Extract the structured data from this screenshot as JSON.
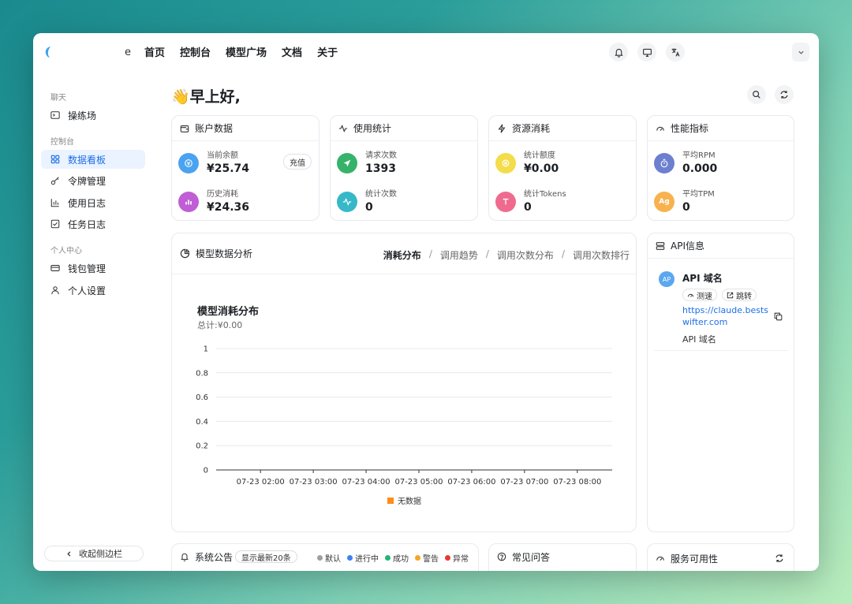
{
  "nav": {
    "logo_tail": "e",
    "items": [
      "首页",
      "控制台",
      "模型广场",
      "文档",
      "关于"
    ]
  },
  "sidebar": {
    "sections": [
      {
        "label": "聊天",
        "items": [
          {
            "label": "操练场"
          }
        ]
      },
      {
        "label": "控制台",
        "items": [
          {
            "label": "数据看板"
          },
          {
            "label": "令牌管理"
          },
          {
            "label": "使用日志"
          },
          {
            "label": "任务日志"
          }
        ]
      },
      {
        "label": "个人中心",
        "items": [
          {
            "label": "钱包管理"
          },
          {
            "label": "个人设置"
          }
        ]
      }
    ],
    "active": "数据看板",
    "collapse_label": "收起侧边栏"
  },
  "greeting": "👋早上好,",
  "account": {
    "title": "账户数据",
    "balance_label": "当前余额",
    "balance_value": "¥25.74",
    "recharge_label": "充值",
    "history_label": "历史消耗",
    "history_value": "¥24.36"
  },
  "usage": {
    "title": "使用统计",
    "requests_label": "请求次数",
    "requests_value": "1393",
    "stat_count_label": "统计次数",
    "stat_count_value": "0"
  },
  "resource": {
    "title": "资源消耗",
    "quota_label": "统计额度",
    "quota_value": "¥0.00",
    "tokens_label": "统计Tokens",
    "tokens_value": "0"
  },
  "performance": {
    "title": "性能指标",
    "rpm_label": "平均RPM",
    "rpm_value": "0.000",
    "rpm_icon": "Ag",
    "tpm_label": "平均TPM",
    "tpm_value": "0"
  },
  "analysis": {
    "title": "模型数据分析",
    "tabs": [
      "消耗分布",
      "调用趋势",
      "调用次数分布",
      "调用次数排行"
    ],
    "active_tab": "消耗分布"
  },
  "chart_data": {
    "type": "bar",
    "title": "模型消耗分布",
    "subtitle": "总计:¥0.00",
    "categories": [
      "07-23 02:00",
      "07-23 03:00",
      "07-23 04:00",
      "07-23 05:00",
      "07-23 06:00",
      "07-23 07:00",
      "07-23 08:00"
    ],
    "y_ticks": [
      "0",
      "0.2",
      "0.4",
      "0.6",
      "0.8",
      "1"
    ],
    "ylim": [
      0,
      1
    ],
    "series": [
      {
        "name": "无数据",
        "values": [
          0,
          0,
          0,
          0,
          0,
          0,
          0
        ],
        "color": "#ff8c1a"
      }
    ],
    "grid": true,
    "legend": "bottom"
  },
  "api": {
    "title": "API信息",
    "avatar": "AP",
    "name": "API 域名",
    "speed_label": "测速",
    "jump_label": "跳转",
    "url": "https://claude.bestswifter.com",
    "desc": "API 域名"
  },
  "notice": {
    "title": "系统公告",
    "pill": "显示最新20条",
    "legend": [
      {
        "label": "默认",
        "color": "#9aa0a6"
      },
      {
        "label": "进行中",
        "color": "#3b82f6"
      },
      {
        "label": "成功",
        "color": "#22b573"
      },
      {
        "label": "警告",
        "color": "#f5a623"
      },
      {
        "label": "异常",
        "color": "#e53935"
      }
    ]
  },
  "faq": {
    "title": "常见问答"
  },
  "availability": {
    "title": "服务可用性"
  }
}
